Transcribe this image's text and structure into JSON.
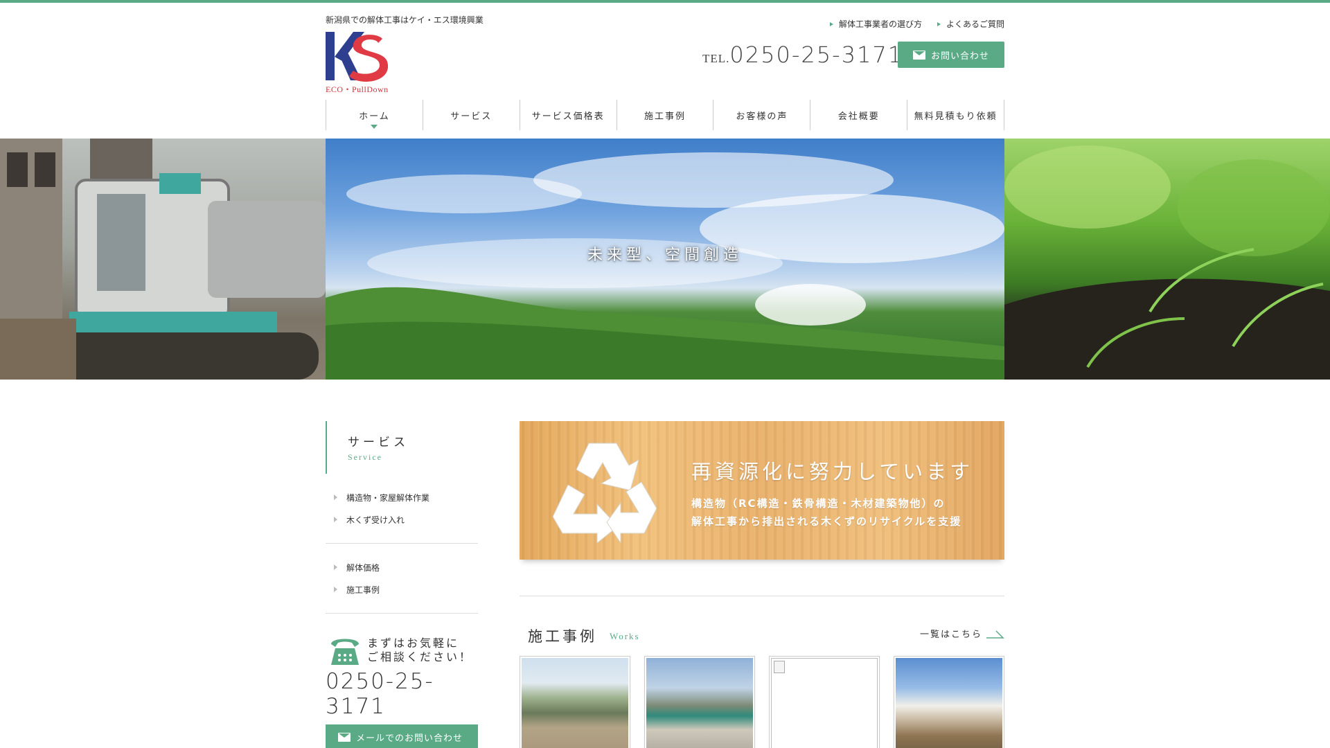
{
  "header": {
    "tagline": "新潟県での解体工事はケイ・エス環境興業",
    "logo_text": "KS",
    "logo_sub": "ECO・PullDown",
    "links": [
      {
        "label": "解体工事業者の選び方"
      },
      {
        "label": "よくあるご質問"
      }
    ],
    "tel_prefix": "TEL.",
    "tel_number": "0250-25-3171",
    "contact_label": "お問い合わせ"
  },
  "nav": [
    {
      "label": "ホーム",
      "active": true
    },
    {
      "label": "サービス"
    },
    {
      "label": "サービス価格表"
    },
    {
      "label": "施工事例"
    },
    {
      "label": "お客様の声"
    },
    {
      "label": "会社概要"
    },
    {
      "label": "無料見積もり依頼"
    }
  ],
  "hero": {
    "title": "未来型、空間創造"
  },
  "sidebar": {
    "heading_jp": "サービス",
    "heading_en": "Service",
    "group1": [
      {
        "label": "構造物・家屋解体作業"
      },
      {
        "label": "木くず受け入れ"
      }
    ],
    "group2": [
      {
        "label": "解体価格"
      },
      {
        "label": "施工事例"
      }
    ],
    "consult_line1": "まずはお気軽に",
    "consult_line2": "ご相談ください！",
    "consult_tel": "0250-25-3171",
    "mail_button": "メールでのお問い合わせ"
  },
  "banner": {
    "title": "再資源化に努力しています",
    "line1": "構造物（RC構造・鉄骨構造・木材建築物他）の",
    "line2": "解体工事から排出される木くずのリサイクルを支援"
  },
  "works": {
    "title": "施工事例",
    "title_en": "Works",
    "more_label": "一覧はこちら",
    "items": [
      {
        "alt": "work-1"
      },
      {
        "alt": "work-2"
      },
      {
        "alt": "work-3"
      },
      {
        "alt": "work-4"
      }
    ]
  },
  "colors": {
    "accent": "#5aaa86",
    "logo_blue": "#2e3f8f",
    "logo_red": "#e03a44"
  }
}
